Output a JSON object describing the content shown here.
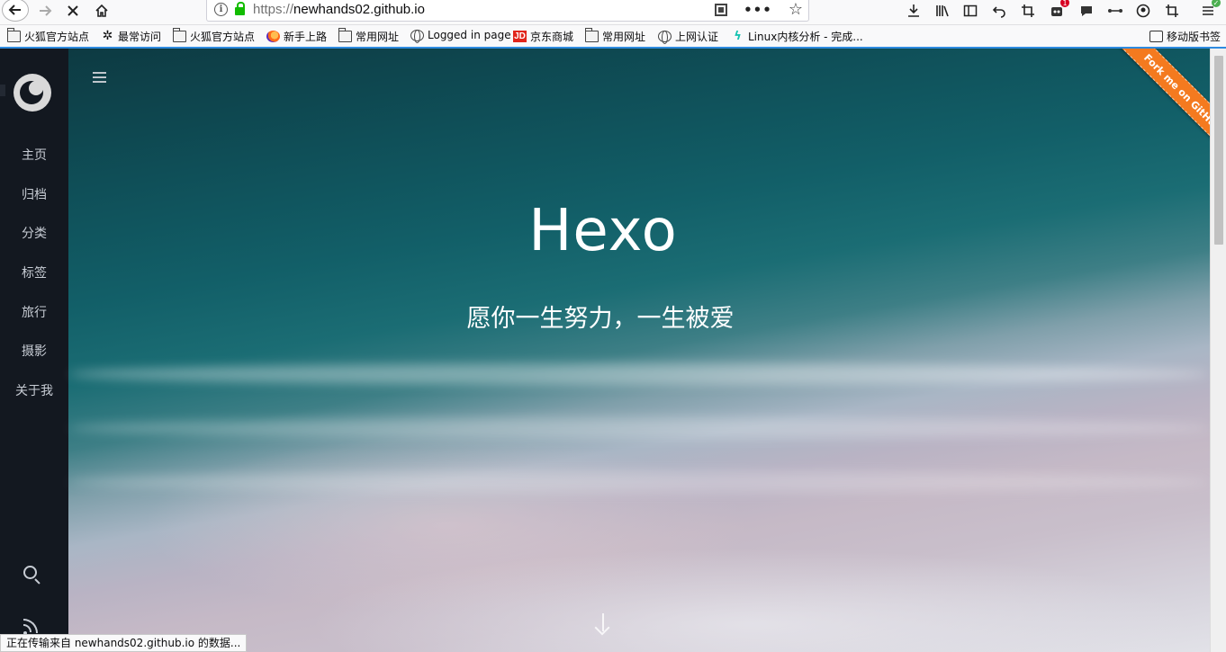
{
  "browser": {
    "url_scheme": "https://",
    "url_host": "newhands02.github.io",
    "info_glyph": "i",
    "more_glyph": "•••",
    "star_glyph": "☆",
    "notification_badge": "1",
    "sync_badge": "✓"
  },
  "bookmarks": [
    {
      "label": "火狐官方站点",
      "icon": "folder-icon"
    },
    {
      "label": "最常访问",
      "icon": "gear-icon"
    },
    {
      "label": "火狐官方站点",
      "icon": "folder-icon"
    },
    {
      "label": "新手上路",
      "icon": "firefox-icon"
    },
    {
      "label": "常用网址",
      "icon": "folder-icon"
    },
    {
      "label": "Logged in page",
      "icon": "globe-icon"
    },
    {
      "label": "京东商城",
      "icon": "jd-icon"
    },
    {
      "label": "常用网址",
      "icon": "folder-icon"
    },
    {
      "label": "上网认证",
      "icon": "globe-icon"
    },
    {
      "label": "Linux内核分析 - 完成...",
      "icon": "leaf-icon"
    }
  ],
  "mobile_bookmarks": "移动版书签",
  "site": {
    "nav": [
      "主页",
      "归档",
      "分类",
      "标签",
      "旅行",
      "摄影",
      "关于我"
    ],
    "title": "Hexo",
    "subtitle": "愿你一生努力，一生被爱",
    "ribbon": "Fork me on GitHub"
  },
  "status_text": "正在传输来自 newhands02.github.io 的数据...",
  "colors": {
    "sidebar_bg": "#131820",
    "ribbon": "#f47a1f",
    "ocean": "#0f4f58",
    "sand": "#c9bfcb"
  }
}
